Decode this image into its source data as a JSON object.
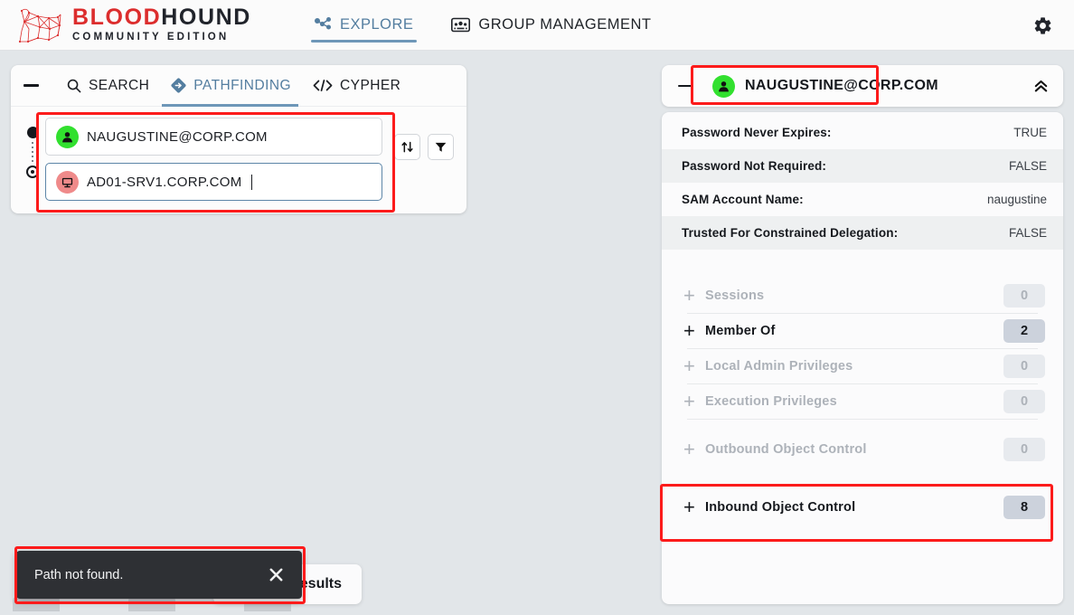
{
  "brand": {
    "line1_a": "BLOOD",
    "line1_b": "HOUND",
    "line2": "COMMUNITY EDITION",
    "accent_red": "#dc2d2d",
    "dark": "#21242b"
  },
  "topnav": {
    "tabs": [
      {
        "label": "EXPLORE",
        "icon": "graph-nodes-icon",
        "active": true
      },
      {
        "label": "GROUP MANAGEMENT",
        "icon": "group-management-icon",
        "active": false
      }
    ],
    "settings_icon": "gear-icon"
  },
  "search_panel": {
    "collapse_icon": "minus-icon",
    "tabs": [
      {
        "label": "SEARCH",
        "icon": "search-icon",
        "active": false
      },
      {
        "label": "PATHFINDING",
        "icon": "pathfinding-diamond-icon",
        "active": true
      },
      {
        "label": "CYPHER",
        "icon": "code-brackets-icon",
        "active": false
      }
    ],
    "start_node": {
      "label": "NAUGUSTINE@CORP.COM",
      "node_type": "user",
      "badge_color": "#32e02f",
      "focused": false
    },
    "end_node": {
      "label": "AD01-SRV1.CORP.COM",
      "node_type": "computer",
      "badge_color": "#ef8a8a",
      "focused": true
    },
    "swap_button": {
      "icon": "swap-vertical-arrows-icon",
      "label": ""
    },
    "filter_button": {
      "icon": "funnel-filter-icon",
      "label": ""
    }
  },
  "entity_panel": {
    "collapse_icon": "minus-icon",
    "title": "NAUGUSTINE@CORP.COM",
    "node_type": "user",
    "badge_color": "#32e02f",
    "expand_icon": "double-chevron-up-icon",
    "properties": [
      {
        "key": "Password Never Expires:",
        "value": "TRUE"
      },
      {
        "key": "Password Not Required:",
        "value": "FALSE"
      },
      {
        "key": "SAM Account Name:",
        "value": "naugustine"
      },
      {
        "key": "Trusted For Constrained Delegation:",
        "value": "FALSE"
      }
    ],
    "sections": [
      {
        "label": "Sessions",
        "count": "0",
        "enabled": false
      },
      {
        "label": "Member Of",
        "count": "2",
        "enabled": true
      },
      {
        "label": "Local Admin Privileges",
        "count": "0",
        "enabled": false
      },
      {
        "label": "Execution Privileges",
        "count": "0",
        "enabled": false
      },
      {
        "label": "Outbound Object Control",
        "count": "0",
        "enabled": false
      },
      {
        "label": "Inbound Object Control",
        "count": "8",
        "enabled": true
      }
    ],
    "expand_glyph": "+"
  },
  "graph": {
    "results_button_label": "Current Results"
  },
  "toast": {
    "message": "Path not found.",
    "close_icon": "close-x-icon",
    "background": "#2e3034"
  },
  "annotations": {
    "highlight_color": "#fc1b1b"
  }
}
